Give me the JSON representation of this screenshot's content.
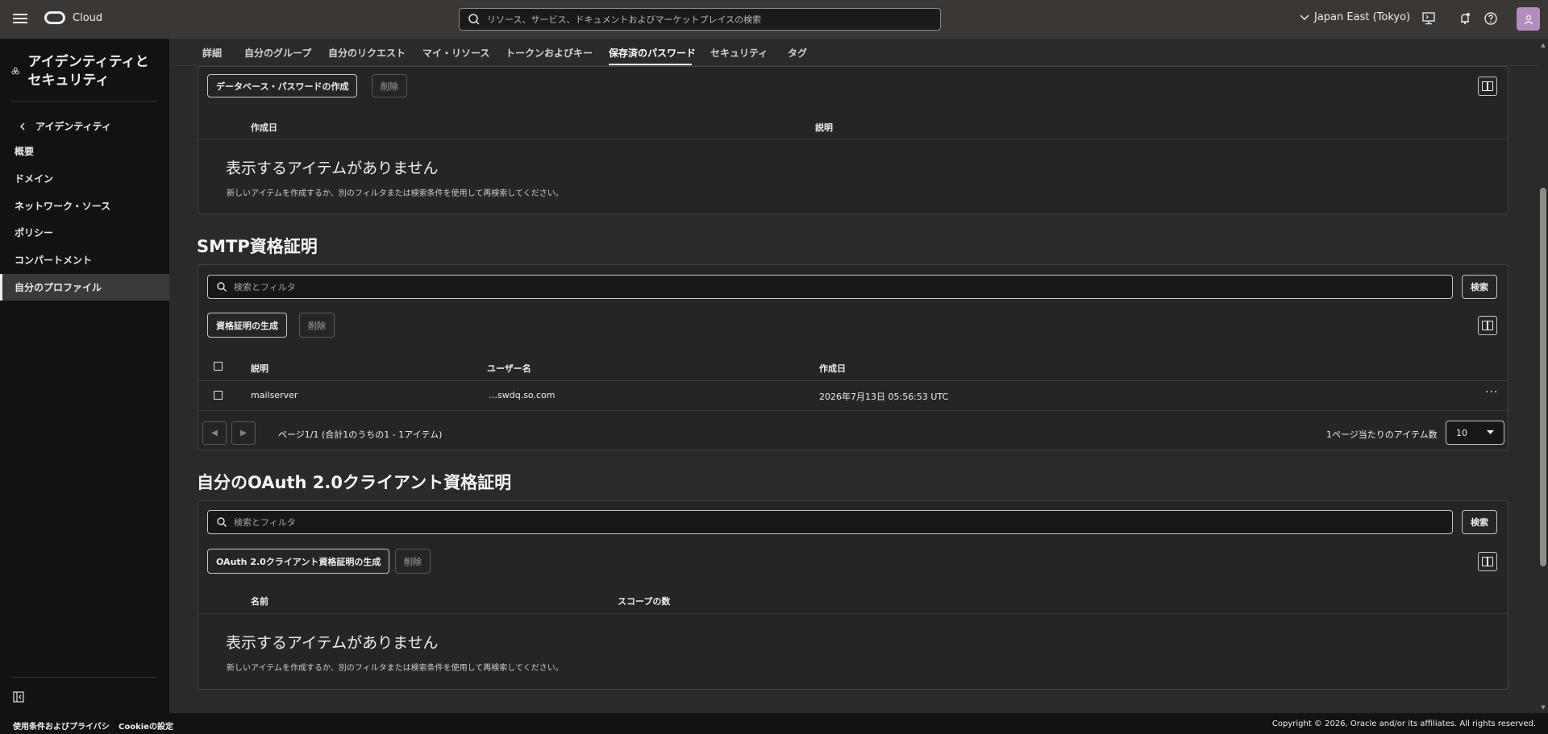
{
  "topbar": {
    "brand": "Cloud",
    "search_placeholder": "リソース、サービス、ドキュメントおよびマーケットプレイスの検索",
    "region": "Japan East (Tokyo)"
  },
  "sidebar": {
    "title": "アイデンティティと セキュリティ",
    "back_label": "アイデンティティ",
    "items": [
      {
        "label": "概要"
      },
      {
        "label": "ドメイン"
      },
      {
        "label": "ネットワーク・ソース"
      },
      {
        "label": "ポリシー"
      },
      {
        "label": "コンパートメント"
      },
      {
        "label": "自分のプロファイル"
      }
    ]
  },
  "tabs": [
    "詳細",
    "自分のグループ",
    "自分のリクエスト",
    "マイ・リソース",
    "トークンおよびキー",
    "保存済のパスワード",
    "セキュリティ",
    "タグ"
  ],
  "active_tab": "保存済のパスワード",
  "db_password": {
    "create_button": "データベース・パスワードの作成",
    "delete_button": "削除",
    "columns": [
      "作成日",
      "説明"
    ],
    "empty_title": "表示するアイテムがありません",
    "empty_sub": "新しいアイテムを作成するか、別のフィルタまたは検索条件を使用して再検索してください。"
  },
  "smtp": {
    "title": "SMTP資格証明",
    "filter_placeholder": "検索とフィルタ",
    "search_button": "検索",
    "generate_button": "資格証明の生成",
    "delete_button": "削除",
    "columns": [
      "説明",
      "ユーザー名",
      "作成日"
    ],
    "rows": [
      {
        "description": "mailserver",
        "username": "…swdq.so.com",
        "created": "2026年7月13日 05:56:53 UTC"
      }
    ],
    "pagination": "ページ1/1 (合計1のうちの1 - 1アイテム)",
    "per_page_label": "1ページ当たりのアイテム数",
    "per_page_value": "10"
  },
  "oauth": {
    "title": "自分のOAuth 2.0クライアント資格証明",
    "filter_placeholder": "検索とフィルタ",
    "search_button": "検索",
    "generate_button": "OAuth 2.0クライアント資格証明の生成",
    "delete_button": "削除",
    "columns": [
      "名前",
      "スコープの数"
    ],
    "empty_title": "表示するアイテムがありません",
    "empty_sub": "新しいアイテムを作成するか、別のフィルタまたは検索条件を使用して再検索してください。"
  },
  "footer": {
    "terms": "使用条件およびプライバシ",
    "cookies": "Cookieの設定",
    "copyright": "Copyright © 2026, Oracle and/or its affiliates. All rights reserved."
  }
}
